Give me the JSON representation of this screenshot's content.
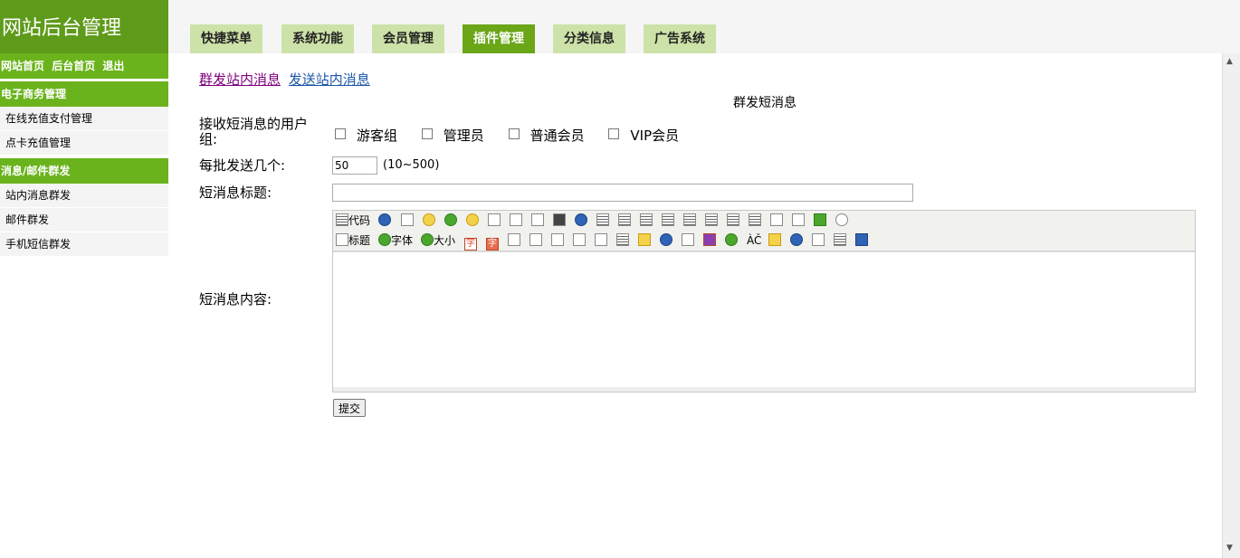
{
  "brand": {
    "title": "网站后台管理"
  },
  "tabs": [
    {
      "label": "快捷菜单",
      "active": false
    },
    {
      "label": "系统功能",
      "active": false
    },
    {
      "label": "会员管理",
      "active": false
    },
    {
      "label": "插件管理",
      "active": true
    },
    {
      "label": "分类信息",
      "active": false
    },
    {
      "label": "广告系统",
      "active": false
    }
  ],
  "sidebar": {
    "top_links": [
      "网站首页",
      "后台首页",
      "退出"
    ],
    "sections": [
      {
        "title": "电子商务管理",
        "items": [
          "在线充值支付管理",
          "点卡充值管理"
        ]
      },
      {
        "title": "消息/邮件群发",
        "items": [
          "站内消息群发",
          "邮件群发",
          "手机短信群发"
        ]
      }
    ]
  },
  "main": {
    "links": {
      "group_msg": "群发站内消息",
      "send_msg": "发送站内消息"
    },
    "form_title": "群发短消息",
    "recv_label": "接收短消息的用户组:",
    "groups": [
      "游客组",
      "管理员",
      "普通会员",
      "VIP会员"
    ],
    "batch_label": "每批发送几个:",
    "batch_value": "50",
    "batch_hint": "(10~500)",
    "subject_label": "短消息标题:",
    "subject_value": "",
    "content_label": "短消息内容:",
    "toolbar": {
      "code": "代码",
      "heading": "标题",
      "font": "字体",
      "size": "大小",
      "char": "字",
      "acc": "ÀČ"
    },
    "submit_label": "提交"
  },
  "colors": {
    "brand_green": "#5f9b1b",
    "sidebar_head": "#6ab31c",
    "tab_inactive": "#cde2a8",
    "tab_active": "#6aa618"
  }
}
